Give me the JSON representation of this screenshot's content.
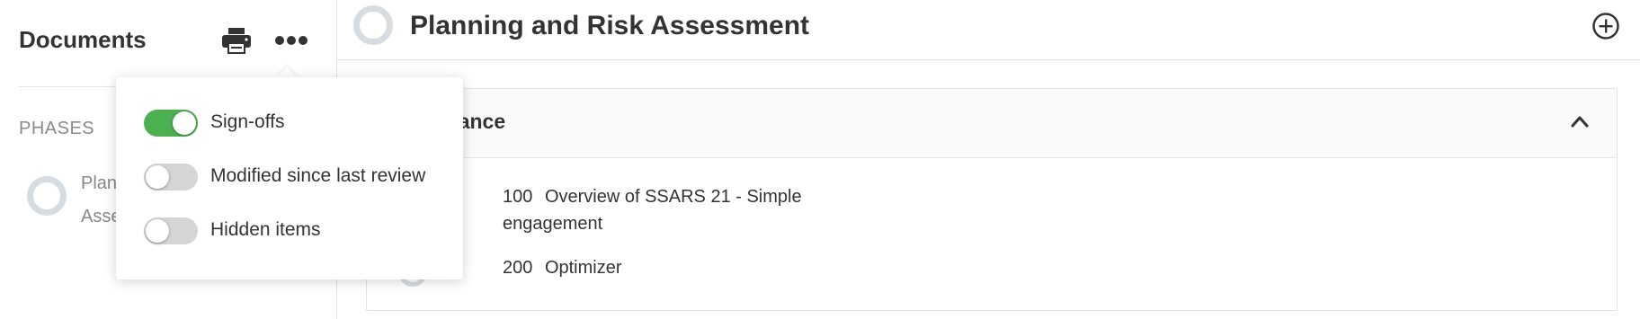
{
  "sidebar": {
    "title": "Documents",
    "print_icon": "printer-icon",
    "more_icon": "more-horizontal-icon",
    "phases_heading": "PHASES",
    "phase_item_label": "Planning and Risk Assessment"
  },
  "header": {
    "title": "Planning and Risk Assessment",
    "add_icon": "plus-circle-icon"
  },
  "section": {
    "title": "Acceptance",
    "chevron_icon": "chevron-up-icon",
    "documents": [
      {
        "number": "100",
        "title": "Overview of SSARS 21 - Simple engagement"
      },
      {
        "number": "200",
        "title": "Optimizer"
      }
    ]
  },
  "popover": {
    "options": [
      {
        "label": "Sign-offs",
        "enabled": true
      },
      {
        "label": "Modified since last review",
        "enabled": false
      },
      {
        "label": "Hidden items",
        "enabled": false
      }
    ]
  },
  "colors": {
    "toggle_on": "#4caf50",
    "toggle_off": "#d5d5d5",
    "ring": "#d7dce0"
  }
}
